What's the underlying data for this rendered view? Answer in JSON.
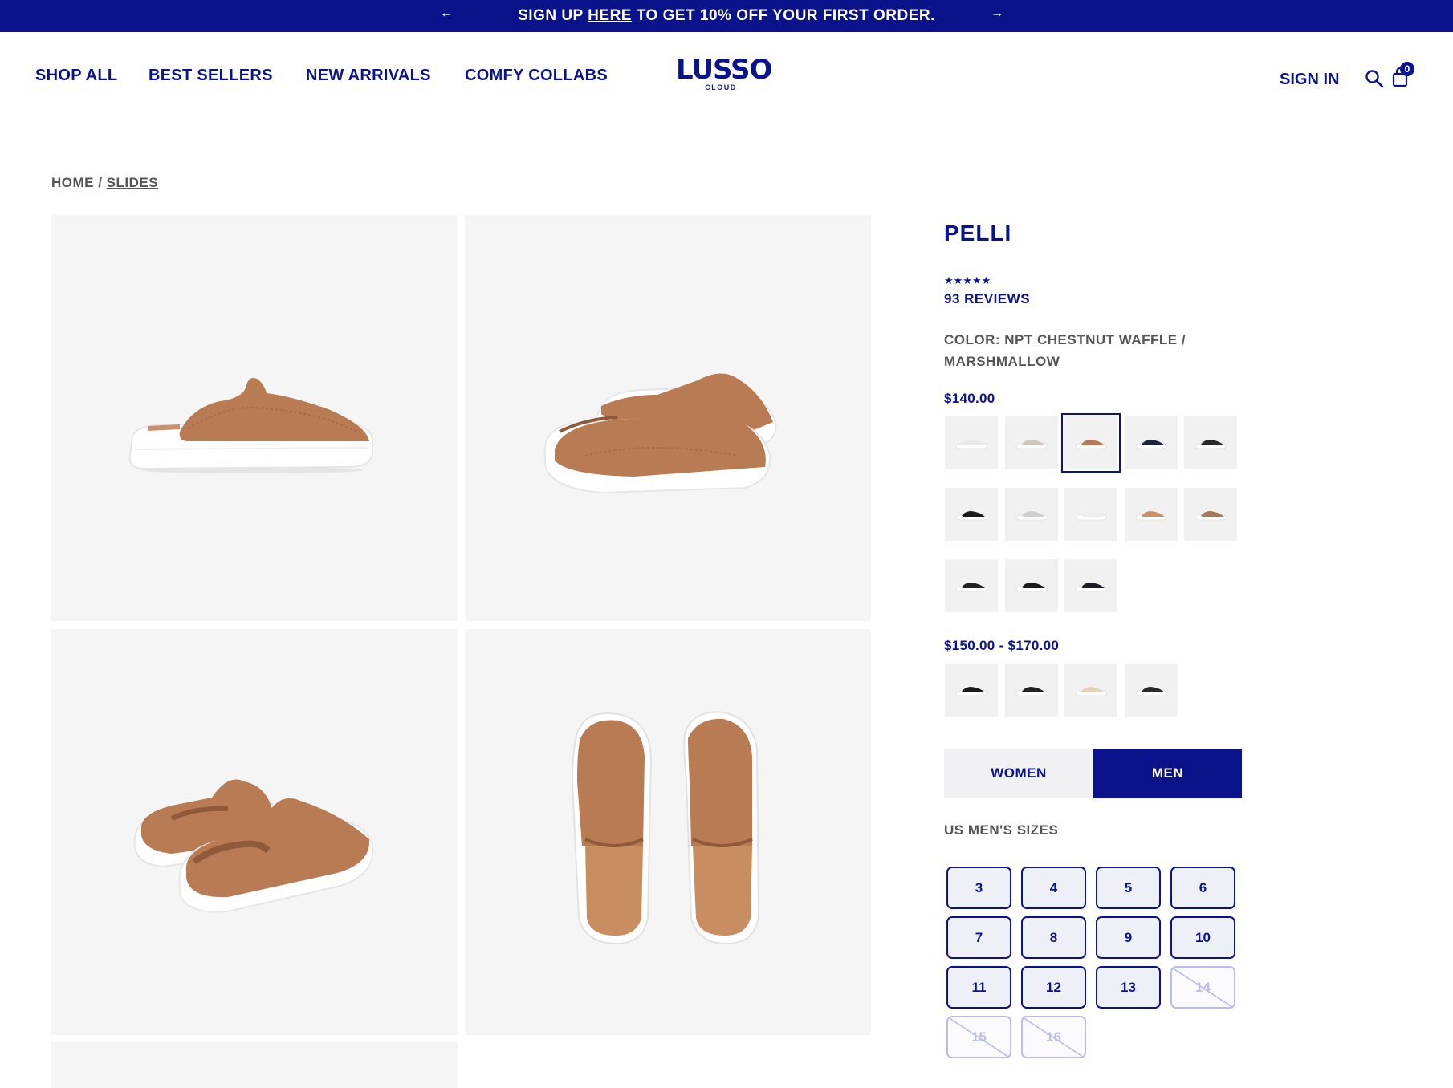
{
  "announcement": {
    "prev_icon": "arrow-left-icon",
    "next_icon": "arrow-right-icon",
    "text_before": "SIGN UP ",
    "link": "HERE",
    "text_after": " TO GET 10% OFF YOUR FIRST ORDER."
  },
  "nav": {
    "items": [
      "SHOP ALL",
      "BEST SELLERS",
      "NEW ARRIVALS",
      "COMFY COLLABS"
    ]
  },
  "logo": {
    "word": "LUSSO",
    "sub": "CLOUD"
  },
  "header": {
    "sign_in": "SIGN IN",
    "search_icon": "search-icon",
    "cart_icon": "shopping-bag-icon",
    "cart_count": "0"
  },
  "breadcrumb": {
    "home": "HOME",
    "separator": " / ",
    "current": "SLIDES"
  },
  "product": {
    "title": "PELLI",
    "rating": {
      "stars": "★★★★★",
      "value": 5,
      "out_of": 5
    },
    "reviews": "93 REVIEWS",
    "color_label": "COLOR: NPT CHESTNUT WAFFLE / MARSHMALLOW",
    "price_1": "$140.00",
    "price_2": "$150.00 - $170.00",
    "gender": {
      "women": "WOMEN",
      "men": "MEN",
      "selected": "MEN"
    },
    "sizes_label": "US MEN'S SIZES",
    "sizes": [
      {
        "label": "3",
        "available": true
      },
      {
        "label": "4",
        "available": true
      },
      {
        "label": "5",
        "available": true
      },
      {
        "label": "6",
        "available": true
      },
      {
        "label": "7",
        "available": true
      },
      {
        "label": "8",
        "available": true
      },
      {
        "label": "9",
        "available": true
      },
      {
        "label": "10",
        "available": true
      },
      {
        "label": "11",
        "available": true
      },
      {
        "label": "12",
        "available": true
      },
      {
        "label": "13",
        "available": true
      },
      {
        "label": "14",
        "available": false
      },
      {
        "label": "15",
        "available": false
      },
      {
        "label": "16",
        "available": false
      }
    ]
  },
  "colors": {
    "brand": "#0a1389",
    "chestnut": "#b97b54",
    "sole": "#ffffff",
    "swatches_group_1": [
      "#e9e9e9",
      "#cfc6bd",
      "#b97b54",
      "#1d2540",
      "#2a2a2a",
      "#1a1a1a",
      "#cfcfcf",
      "#efefef",
      "#c89168",
      "#a9775a",
      "#222222",
      "#1a1a1a",
      "#1b1b26"
    ],
    "swatches_group_2": [
      "#1a1a1a",
      "#222222",
      "#e6d2b8",
      "#2a2a2a"
    ]
  }
}
